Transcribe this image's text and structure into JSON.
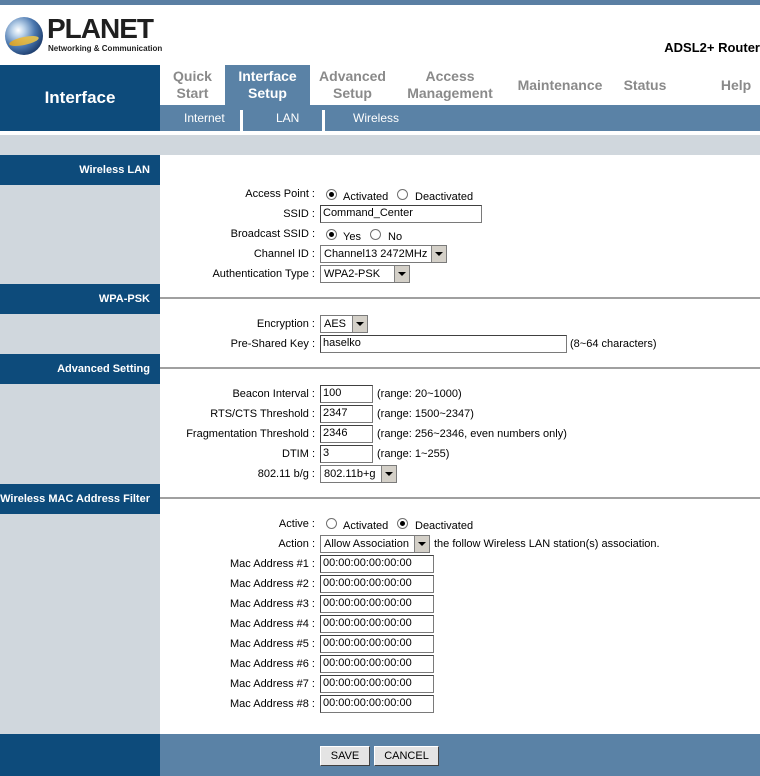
{
  "brand": {
    "logo_text": "PLANET",
    "logo_sub": "Networking & Communication",
    "product": "ADSL2+ Router"
  },
  "nav": {
    "section_title": "Interface",
    "tabs": [
      {
        "line1": "Quick",
        "line2": "Start"
      },
      {
        "line1": "Interface",
        "line2": "Setup"
      },
      {
        "line1": "Advanced",
        "line2": "Setup"
      },
      {
        "line1": "Access",
        "line2": "Management"
      },
      {
        "line1": "Maintenance",
        "line2": ""
      },
      {
        "line1": "Status",
        "line2": ""
      },
      {
        "line1": "Help",
        "line2": ""
      }
    ],
    "subtabs": [
      "Internet",
      "LAN",
      "Wireless"
    ]
  },
  "sections": {
    "wireless_lan": "Wireless LAN",
    "wpa_psk": "WPA-PSK",
    "advanced": "Advanced Setting",
    "mac_filter": "Wireless MAC Address Filter"
  },
  "wireless_lan": {
    "access_point_label": "Access Point :",
    "activated": "Activated",
    "deactivated": "Deactivated",
    "ssid_label": "SSID :",
    "ssid_value": "Command_Center",
    "broadcast_label": "Broadcast SSID :",
    "yes": "Yes",
    "no": "No",
    "channel_label": "Channel ID :",
    "channel_value": "Channel13 2472MHz",
    "auth_label": "Authentication Type :",
    "auth_value": "WPA2-PSK"
  },
  "wpa": {
    "encryption_label": "Encryption :",
    "encryption_value": "AES",
    "psk_label": "Pre-Shared Key :",
    "psk_value": "haselko",
    "psk_hint": "(8~64 characters)"
  },
  "advanced": {
    "beacon_label": "Beacon Interval :",
    "beacon_value": "100",
    "beacon_hint": "(range: 20~1000)",
    "rts_label": "RTS/CTS Threshold :",
    "rts_value": "2347",
    "rts_hint": "(range: 1500~2347)",
    "frag_label": "Fragmentation Threshold :",
    "frag_value": "2346",
    "frag_hint": "(range: 256~2346, even numbers only)",
    "dtim_label": "DTIM :",
    "dtim_value": "3",
    "dtim_hint": "(range: 1~255)",
    "mode_label": "802.11 b/g :",
    "mode_value": "802.11b+g"
  },
  "mac_filter": {
    "active_label": "Active :",
    "activated": "Activated",
    "deactivated": "Deactivated",
    "action_label": "Action :",
    "action_value": "Allow Association",
    "action_hint": "the follow Wireless LAN station(s) association.",
    "addresses": [
      {
        "label": "Mac Address #1 :",
        "value": "00:00:00:00:00:00"
      },
      {
        "label": "Mac Address #2 :",
        "value": "00:00:00:00:00:00"
      },
      {
        "label": "Mac Address #3 :",
        "value": "00:00:00:00:00:00"
      },
      {
        "label": "Mac Address #4 :",
        "value": "00:00:00:00:00:00"
      },
      {
        "label": "Mac Address #5 :",
        "value": "00:00:00:00:00:00"
      },
      {
        "label": "Mac Address #6 :",
        "value": "00:00:00:00:00:00"
      },
      {
        "label": "Mac Address #7 :",
        "value": "00:00:00:00:00:00"
      },
      {
        "label": "Mac Address #8 :",
        "value": "00:00:00:00:00:00"
      }
    ]
  },
  "footer": {
    "save": "SAVE",
    "cancel": "CANCEL"
  },
  "colors": {
    "nav_dark": "#0d4b7b",
    "nav_mid": "#5a82a6",
    "sidebar": "#d0d7dd"
  }
}
